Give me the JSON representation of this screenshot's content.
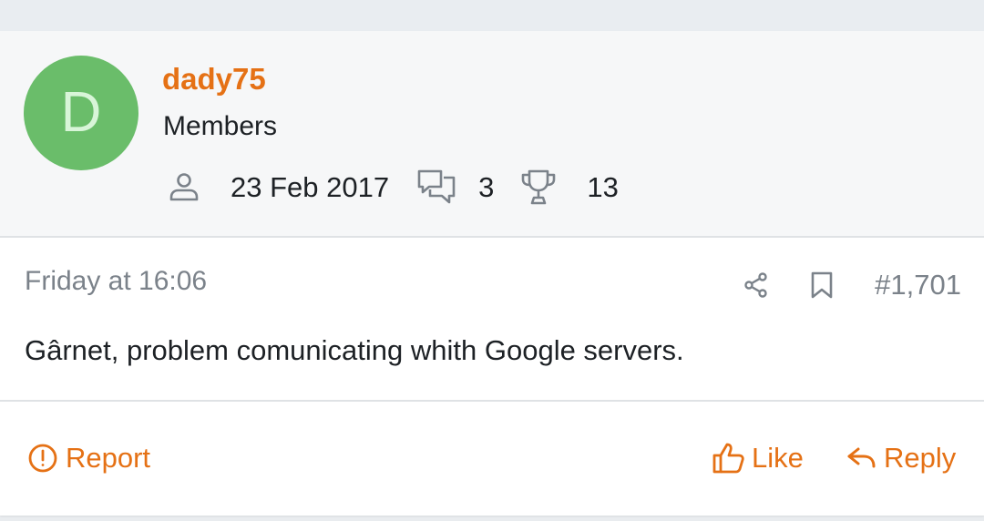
{
  "author": {
    "avatar_letter": "D",
    "avatar_color": "#6abd6a",
    "username": "dady75",
    "title": "Members",
    "joined": "23 Feb 2017",
    "messages": "3",
    "points": "13",
    "icons": {
      "joined": "user-icon",
      "messages": "comments-icon",
      "points": "trophy-icon"
    }
  },
  "post": {
    "date": "Friday at 16:06",
    "number": "#1,701",
    "message": "Gârnet, problem comunicating whith Google servers.",
    "tool_icons": [
      "share-icon",
      "bookmark-icon"
    ]
  },
  "actions": {
    "report": "Report",
    "like": "Like",
    "reply": "Reply"
  },
  "colors": {
    "accent": "#e57115",
    "muted": "#7b828a",
    "text": "#1d2125"
  }
}
